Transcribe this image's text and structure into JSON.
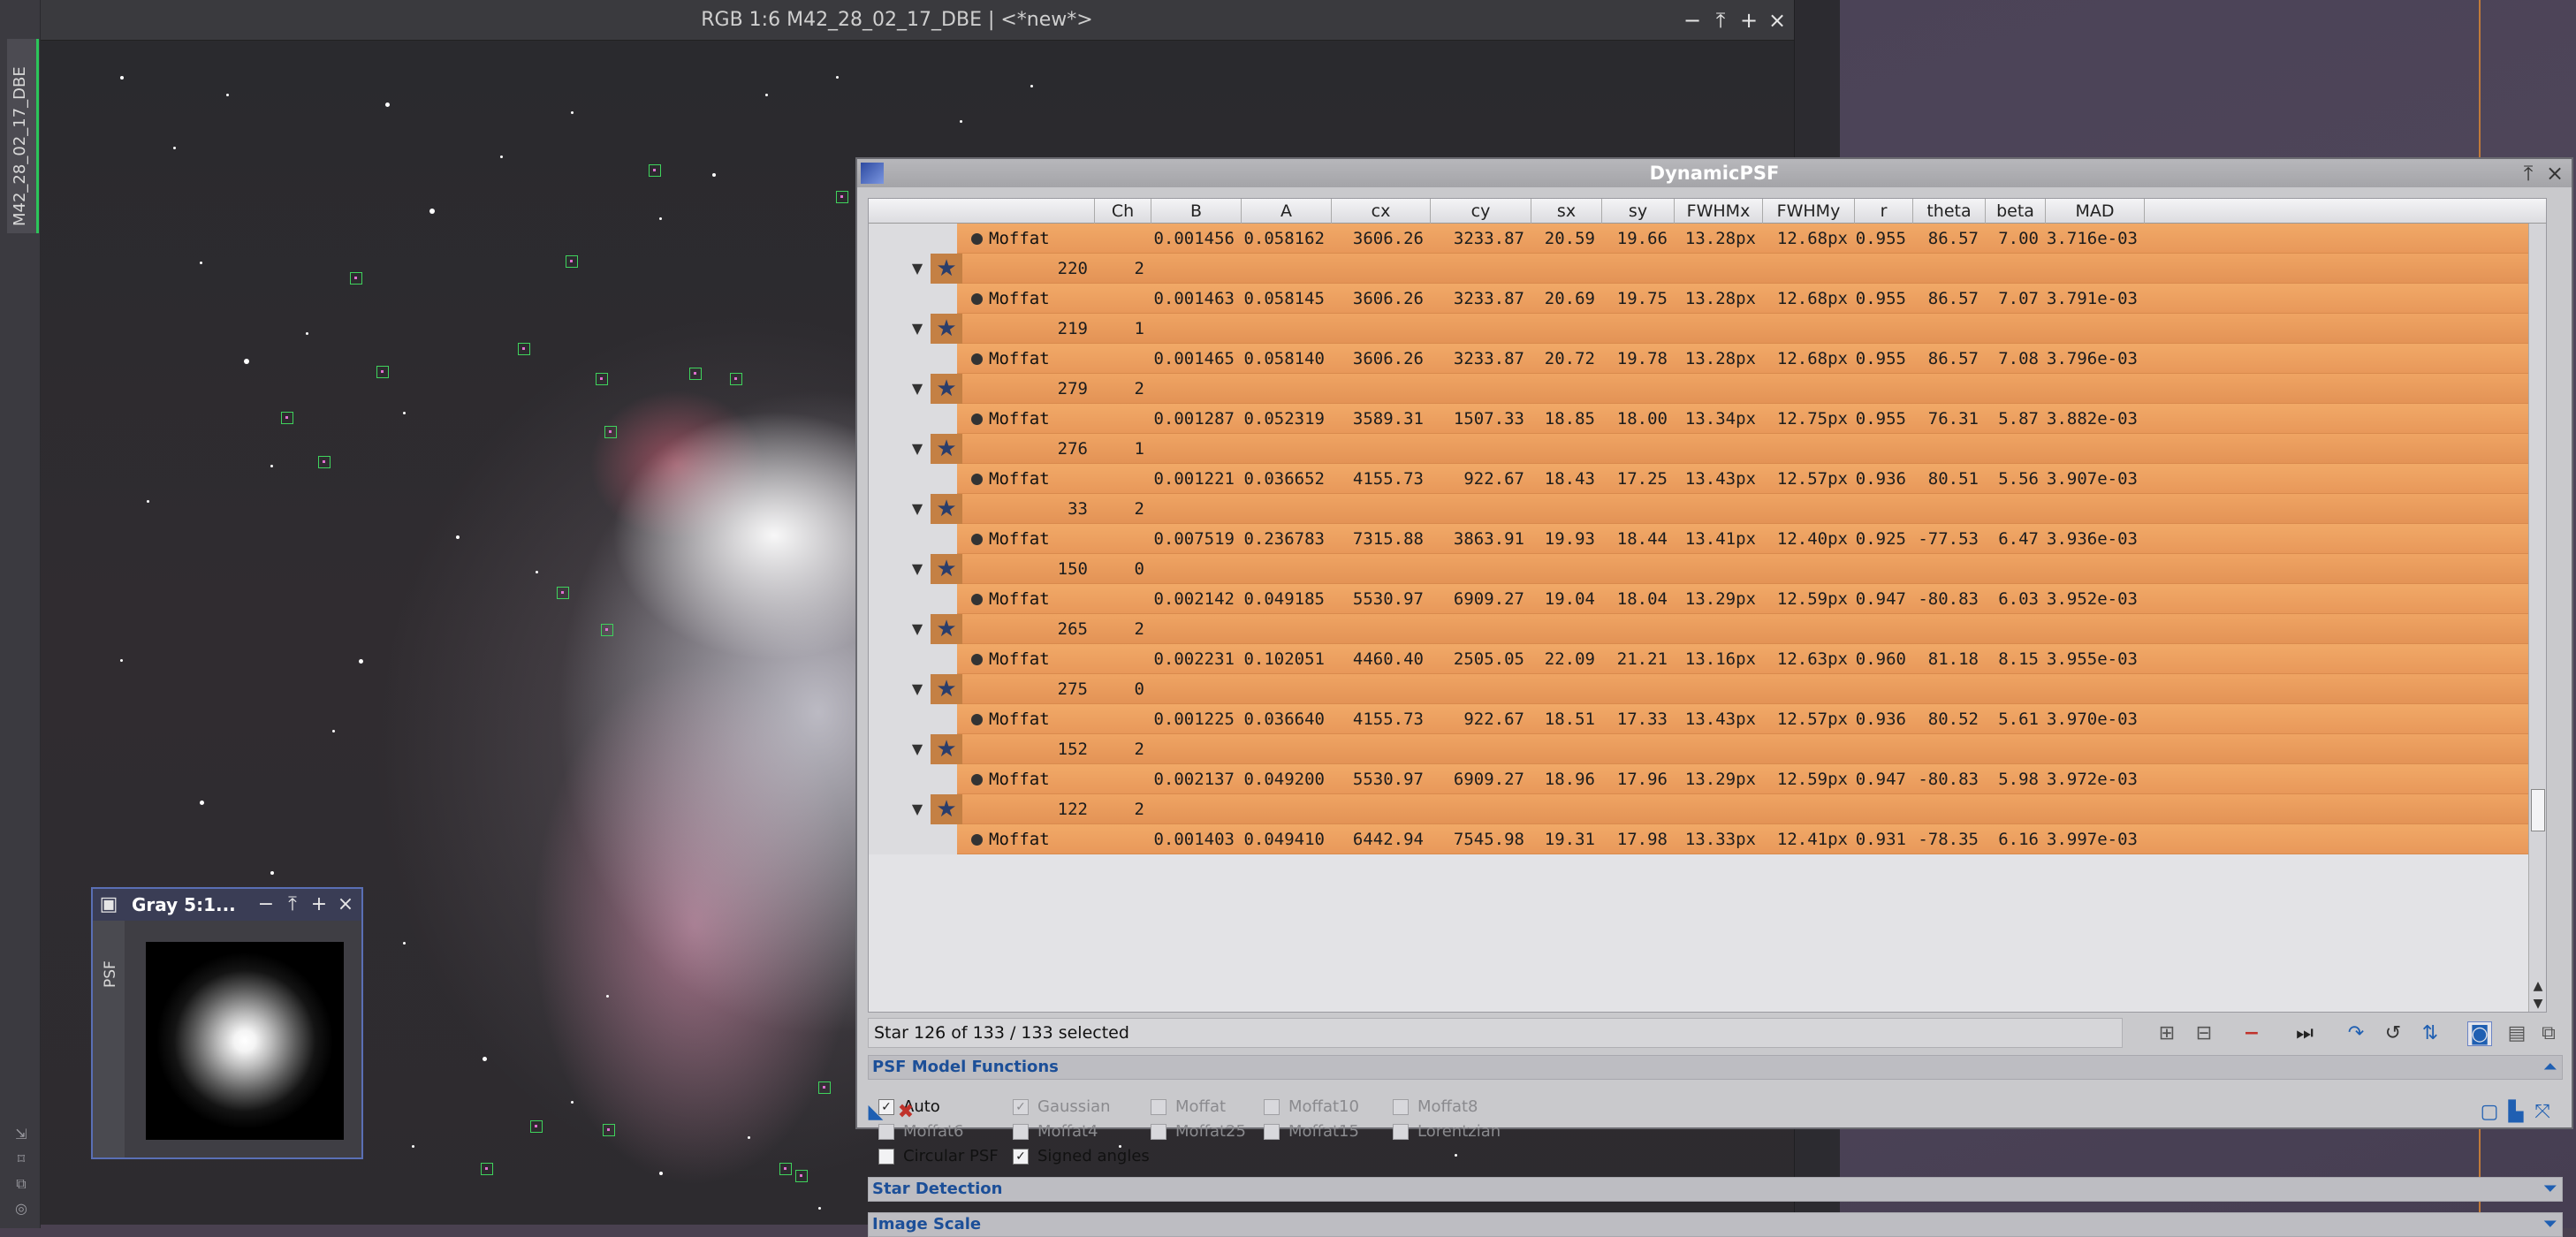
{
  "image_window": {
    "title": "RGB 1:6 M42_28_02_17_DBE | <*new*>",
    "side_tab": "M42_28_02_17_DBE"
  },
  "psf_window": {
    "title": "Gray 5:1...",
    "side_tab": "PSF"
  },
  "dynamic_psf": {
    "title": "DynamicPSF",
    "columns": [
      "Ch",
      "B",
      "A",
      "cx",
      "cy",
      "sx",
      "sy",
      "FWHMx",
      "FWHMy",
      "r",
      "theta",
      "beta",
      "MAD"
    ],
    "rows": [
      {
        "type": "func",
        "name": "Moffat",
        "B": "0.001456",
        "A": "0.058162",
        "cx": "3606.26",
        "cy": "3233.87",
        "sx": "20.59",
        "sy": "19.66",
        "FWHMx": "13.28px",
        "FWHMy": "12.68px",
        "r": "0.955",
        "theta": "86.57",
        "beta": "7.00",
        "MAD": "3.716e-03"
      },
      {
        "type": "star",
        "id": "220",
        "ch": "2"
      },
      {
        "type": "func",
        "name": "Moffat",
        "B": "0.001463",
        "A": "0.058145",
        "cx": "3606.26",
        "cy": "3233.87",
        "sx": "20.69",
        "sy": "19.75",
        "FWHMx": "13.28px",
        "FWHMy": "12.68px",
        "r": "0.955",
        "theta": "86.57",
        "beta": "7.07",
        "MAD": "3.791e-03"
      },
      {
        "type": "star",
        "id": "219",
        "ch": "1"
      },
      {
        "type": "func",
        "name": "Moffat",
        "B": "0.001465",
        "A": "0.058140",
        "cx": "3606.26",
        "cy": "3233.87",
        "sx": "20.72",
        "sy": "19.78",
        "FWHMx": "13.28px",
        "FWHMy": "12.68px",
        "r": "0.955",
        "theta": "86.57",
        "beta": "7.08",
        "MAD": "3.796e-03"
      },
      {
        "type": "star",
        "id": "279",
        "ch": "2"
      },
      {
        "type": "func",
        "name": "Moffat",
        "B": "0.001287",
        "A": "0.052319",
        "cx": "3589.31",
        "cy": "1507.33",
        "sx": "18.85",
        "sy": "18.00",
        "FWHMx": "13.34px",
        "FWHMy": "12.75px",
        "r": "0.955",
        "theta": "76.31",
        "beta": "5.87",
        "MAD": "3.882e-03"
      },
      {
        "type": "star",
        "id": "276",
        "ch": "1"
      },
      {
        "type": "func",
        "name": "Moffat",
        "B": "0.001221",
        "A": "0.036652",
        "cx": "4155.73",
        "cy": "922.67",
        "sx": "18.43",
        "sy": "17.25",
        "FWHMx": "13.43px",
        "FWHMy": "12.57px",
        "r": "0.936",
        "theta": "80.51",
        "beta": "5.56",
        "MAD": "3.907e-03"
      },
      {
        "type": "star",
        "id": "33",
        "ch": "2"
      },
      {
        "type": "func",
        "name": "Moffat",
        "B": "0.007519",
        "A": "0.236783",
        "cx": "7315.88",
        "cy": "3863.91",
        "sx": "19.93",
        "sy": "18.44",
        "FWHMx": "13.41px",
        "FWHMy": "12.40px",
        "r": "0.925",
        "theta": "-77.53",
        "beta": "6.47",
        "MAD": "3.936e-03"
      },
      {
        "type": "star",
        "id": "150",
        "ch": "0"
      },
      {
        "type": "func",
        "name": "Moffat",
        "B": "0.002142",
        "A": "0.049185",
        "cx": "5530.97",
        "cy": "6909.27",
        "sx": "19.04",
        "sy": "18.04",
        "FWHMx": "13.29px",
        "FWHMy": "12.59px",
        "r": "0.947",
        "theta": "-80.83",
        "beta": "6.03",
        "MAD": "3.952e-03"
      },
      {
        "type": "star",
        "id": "265",
        "ch": "2"
      },
      {
        "type": "func",
        "name": "Moffat",
        "B": "0.002231",
        "A": "0.102051",
        "cx": "4460.40",
        "cy": "2505.05",
        "sx": "22.09",
        "sy": "21.21",
        "FWHMx": "13.16px",
        "FWHMy": "12.63px",
        "r": "0.960",
        "theta": "81.18",
        "beta": "8.15",
        "MAD": "3.955e-03"
      },
      {
        "type": "star",
        "id": "275",
        "ch": "0"
      },
      {
        "type": "func",
        "name": "Moffat",
        "B": "0.001225",
        "A": "0.036640",
        "cx": "4155.73",
        "cy": "922.67",
        "sx": "18.51",
        "sy": "17.33",
        "FWHMx": "13.43px",
        "FWHMy": "12.57px",
        "r": "0.936",
        "theta": "80.52",
        "beta": "5.61",
        "MAD": "3.970e-03"
      },
      {
        "type": "star",
        "id": "152",
        "ch": "2"
      },
      {
        "type": "func",
        "name": "Moffat",
        "B": "0.002137",
        "A": "0.049200",
        "cx": "5530.97",
        "cy": "6909.27",
        "sx": "18.96",
        "sy": "17.96",
        "FWHMx": "13.29px",
        "FWHMy": "12.59px",
        "r": "0.947",
        "theta": "-80.83",
        "beta": "5.98",
        "MAD": "3.972e-03"
      },
      {
        "type": "star",
        "id": "122",
        "ch": "2"
      },
      {
        "type": "func",
        "name": "Moffat",
        "B": "0.001403",
        "A": "0.049410",
        "cx": "6442.94",
        "cy": "7545.98",
        "sx": "19.31",
        "sy": "17.98",
        "FWHMx": "13.33px",
        "FWHMy": "12.41px",
        "r": "0.931",
        "theta": "-78.35",
        "beta": "6.16",
        "MAD": "3.997e-03"
      }
    ],
    "status": "Star   126 of   133 / 133 selected",
    "sections": {
      "psf_model": "PSF Model Functions",
      "star_detection": "Star Detection",
      "image_scale": "Image Scale"
    },
    "options": [
      {
        "label": "Auto",
        "checked": true,
        "disabled": false
      },
      {
        "label": "Gaussian",
        "checked": true,
        "disabled": true
      },
      {
        "label": "Moffat",
        "checked": false,
        "disabled": true
      },
      {
        "label": "Moffat10",
        "checked": false,
        "disabled": true
      },
      {
        "label": "Moffat8",
        "checked": false,
        "disabled": true
      },
      {
        "label": "Moffat6",
        "checked": false,
        "disabled": true
      },
      {
        "label": "Moffat4",
        "checked": false,
        "disabled": true
      },
      {
        "label": "Moffat25",
        "checked": false,
        "disabled": true
      },
      {
        "label": "Moffat15",
        "checked": false,
        "disabled": true
      },
      {
        "label": "Lorentzian",
        "checked": false,
        "disabled": true
      },
      {
        "label": "Circular PSF",
        "checked": false,
        "disabled": false
      },
      {
        "label": "Signed angles",
        "checked": true,
        "disabled": false
      }
    ]
  }
}
